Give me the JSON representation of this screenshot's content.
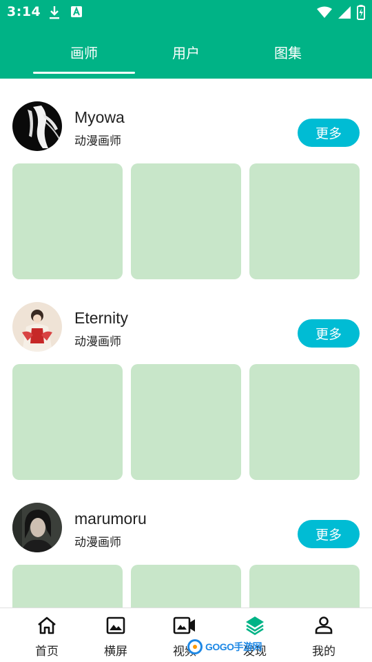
{
  "status_bar": {
    "time": "3:14",
    "icons": [
      "download-icon",
      "a-badge-icon",
      "wifi-icon",
      "signal-icon",
      "battery-icon"
    ]
  },
  "tabs": [
    {
      "label": "画师",
      "active": true
    },
    {
      "label": "用户",
      "active": false
    },
    {
      "label": "图集",
      "active": false
    }
  ],
  "artists": [
    {
      "name": "Myowa",
      "role": "动漫画师",
      "more_label": "更多"
    },
    {
      "name": "Eternity",
      "role": "动漫画师",
      "more_label": "更多"
    },
    {
      "name": "marumoru",
      "role": "动漫画师",
      "more_label": "更多"
    }
  ],
  "bottom_nav": [
    {
      "label": "首页",
      "icon": "home-icon"
    },
    {
      "label": "横屏",
      "icon": "image-icon"
    },
    {
      "label": "视频",
      "icon": "video-camera-icon"
    },
    {
      "label": "发现",
      "icon": "layers-icon"
    },
    {
      "label": "我的",
      "icon": "person-icon"
    }
  ],
  "watermark": {
    "text": "GOGO手游网"
  },
  "colors": {
    "primary": "#00b386",
    "accent_button": "#00bcd4",
    "thumb_placeholder": "#c8e6c9"
  }
}
